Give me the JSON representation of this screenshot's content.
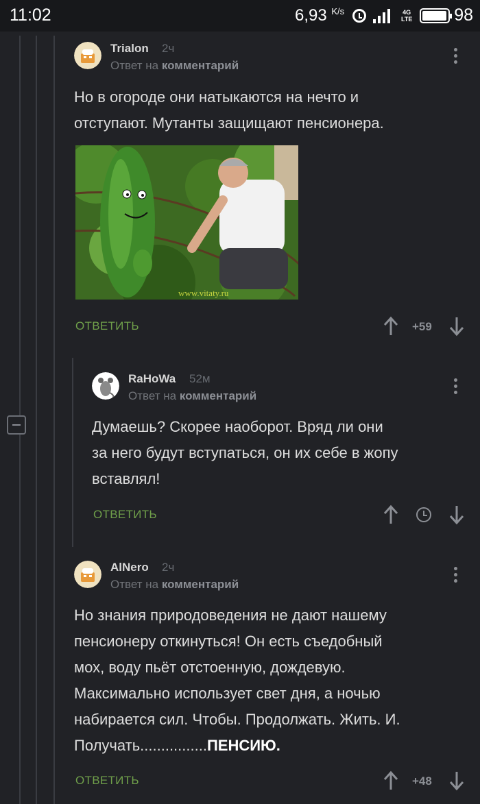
{
  "status_bar": {
    "time": "11:02",
    "speed": "6,93",
    "speed_unit": "K/s",
    "network": "4G LTE",
    "battery": "98"
  },
  "comments": [
    {
      "author": "Trialon",
      "time": "2ч",
      "reply_prefix": "Ответ на",
      "reply_target": "комментарий",
      "lines": [
        "Но в огороде они натыкаются на нечто и",
        "отступают. Мутанты защищают пенсионера."
      ],
      "image_watermark": "www.vitaty.ru",
      "reply_label": "ОТВЕТИТЬ",
      "score": "+59"
    },
    {
      "author": "RaHoWa",
      "time": "52м",
      "reply_prefix": "Ответ на",
      "reply_target": "комментарий",
      "lines": [
        "Думаешь? Скорее наоборот. Вряд ли они",
        "за него будут вступаться, он их себе в жопу",
        "вставлял!"
      ],
      "reply_label": "ОТВЕТИТЬ"
    },
    {
      "author": "AlNero",
      "time": "2ч",
      "reply_prefix": "Ответ на",
      "reply_target": "комментарий",
      "lines": [
        "Но знания природоведения не дают нашему",
        "пенсионеру откинуться! Он есть съедобный",
        "мох, воду пьёт отстоенную, дождевую.",
        "Максимально использует свет дня, а ночью",
        "набирается сил. Чтобы. Продолжать. Жить. И."
      ],
      "last_line_prefix": "Получать................",
      "last_line_bold": "ПЕНСИЮ.",
      "reply_label": "ОТВЕТИТЬ",
      "score": "+48"
    }
  ],
  "colors": {
    "background": "#212226",
    "status_bar": "#17181b",
    "reply_green": "#6f9f4a",
    "thread_line": "#3a3c42"
  }
}
